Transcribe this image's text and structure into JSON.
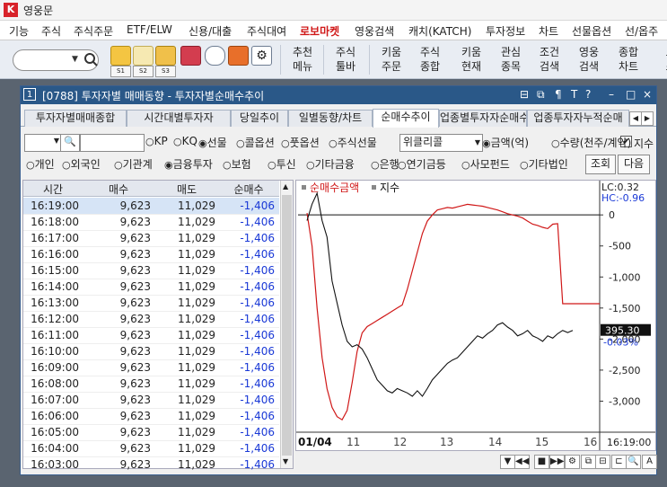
{
  "app": {
    "title": "영웅문",
    "logo": "K"
  },
  "menu": [
    "기능",
    "주식",
    "주식주문",
    "ETF/ELW",
    "신용/대출",
    "주식대여",
    "로보마켓",
    "영웅검색",
    "캐치(KATCH)",
    "투자정보",
    "차트",
    "선물옵션",
    "선/옵주"
  ],
  "menu_highlight": "로보마켓",
  "toolbar": {
    "sub_labels": [
      "S1",
      "S2",
      "S3"
    ],
    "buttons": [
      {
        "line1": "추천",
        "line2": "메뉴"
      },
      {
        "line1": "주식",
        "line2": "툴바"
      },
      {
        "line1": "키움",
        "line2": "주문"
      },
      {
        "line1": "주식",
        "line2": "종합"
      },
      {
        "line1": "키움",
        "line2": "현재"
      },
      {
        "line1": "관심",
        "line2": "종목"
      },
      {
        "line1": "조건",
        "line2": "검색"
      },
      {
        "line1": "영웅",
        "line2": "검색"
      },
      {
        "line1": "종합",
        "line2": "차트"
      },
      {
        "line1": "오",
        "line2": "스"
      }
    ]
  },
  "window": {
    "number": "1",
    "title": "[0788] 투자자별 매매동향 - 투자자별순매수추이",
    "controls": [
      "⊟",
      "⧉",
      "¶",
      "T",
      "?",
      "–",
      "□",
      "×"
    ]
  },
  "tabs": [
    {
      "label": "투자자별매매종합",
      "active": false
    },
    {
      "label": "시간대별투자자",
      "active": false
    },
    {
      "label": "당일추이",
      "active": false
    },
    {
      "label": "일별동향/차트",
      "active": false
    },
    {
      "label": "순매수추이",
      "active": true
    },
    {
      "label": "업종별투자자순매수",
      "active": false
    },
    {
      "label": "업종투자자누적순매",
      "active": false
    }
  ],
  "row1": {
    "market_options": [
      "KP",
      "KQ",
      "선물",
      "콜옵션",
      "풋옵션",
      "주식선물"
    ],
    "market_selected": "선물",
    "weekly_select": "위클리콜",
    "unit_options": [
      "금액(억)",
      "수량(천주/계약)"
    ],
    "unit_selected": "금액(억)",
    "index_check_label": "지수",
    "index_checked": true
  },
  "row2": {
    "investor_options": [
      "개인",
      "외국인",
      "기관계",
      "금융투자",
      "보험",
      "투신",
      "기타금융",
      "은행",
      "연기금등",
      "사모펀드",
      "기타법인"
    ],
    "investor_selected": "금융투자",
    "query_button": "조회",
    "next_button": "다음"
  },
  "table": {
    "headers": [
      "시간",
      "매수",
      "매도",
      "순매수"
    ],
    "rows": [
      [
        "16:19:00",
        "9,623",
        "11,029",
        "-1,406"
      ],
      [
        "16:18:00",
        "9,623",
        "11,029",
        "-1,406"
      ],
      [
        "16:17:00",
        "9,623",
        "11,029",
        "-1,406"
      ],
      [
        "16:16:00",
        "9,623",
        "11,029",
        "-1,406"
      ],
      [
        "16:15:00",
        "9,623",
        "11,029",
        "-1,406"
      ],
      [
        "16:14:00",
        "9,623",
        "11,029",
        "-1,406"
      ],
      [
        "16:13:00",
        "9,623",
        "11,029",
        "-1,406"
      ],
      [
        "16:12:00",
        "9,623",
        "11,029",
        "-1,406"
      ],
      [
        "16:11:00",
        "9,623",
        "11,029",
        "-1,406"
      ],
      [
        "16:10:00",
        "9,623",
        "11,029",
        "-1,406"
      ],
      [
        "16:09:00",
        "9,623",
        "11,029",
        "-1,406"
      ],
      [
        "16:08:00",
        "9,623",
        "11,029",
        "-1,406"
      ],
      [
        "16:07:00",
        "9,623",
        "11,029",
        "-1,406"
      ],
      [
        "16:06:00",
        "9,623",
        "11,029",
        "-1,406"
      ],
      [
        "16:05:00",
        "9,623",
        "11,029",
        "-1,406"
      ],
      [
        "16:04:00",
        "9,623",
        "11,029",
        "-1,406"
      ],
      [
        "16:03:00",
        "9,623",
        "11,029",
        "-1,406"
      ]
    ]
  },
  "chart_data": {
    "type": "line",
    "legend": [
      {
        "name": "순매수금액",
        "color": "#d01818"
      },
      {
        "name": "지수",
        "color": "#111111"
      }
    ],
    "info": {
      "lc": "LC:0.32",
      "hc": "HC:-0.96"
    },
    "y_ticks": [
      "0",
      "-500",
      "-1,000",
      "-1,500",
      "-2,000",
      "-2,500",
      "-3,000"
    ],
    "y_tick_values": [
      0,
      -500,
      -1000,
      -1500,
      -2000,
      -2500,
      -3000
    ],
    "ylim": [
      -3500,
      350
    ],
    "current_price": "395.30",
    "current_change": "-0.03%",
    "x_ticks": [
      "01/04",
      "11",
      "12",
      "13",
      "14",
      "15",
      "16"
    ],
    "time_label": "16:19:00",
    "series": [
      {
        "name": "순매수금액",
        "color": "#d01818",
        "values": [
          30,
          -500,
          -1500,
          -2300,
          -2800,
          -3100,
          -3250,
          -3300,
          -3150,
          -2700,
          -2200,
          -1900,
          -1800,
          -1750,
          -1700,
          -1650,
          -1600,
          -1550,
          -1500,
          -1450,
          -1200,
          -900,
          -600,
          -300,
          -100,
          0,
          80,
          100,
          120,
          110,
          130,
          150,
          170,
          160,
          150,
          140,
          120,
          100,
          80,
          50,
          20,
          0,
          -20,
          -50,
          -100,
          -150,
          -170,
          -200,
          -220,
          -150,
          -140,
          -1430,
          -1430,
          -1430
        ]
      },
      {
        "name": "지수",
        "color": "#111111",
        "values": [
          395.55,
          395.7,
          395.8,
          395.55,
          395.4,
          395.0,
          394.8,
          394.6,
          394.45,
          394.4,
          394.42,
          394.38,
          394.3,
          394.2,
          394.1,
          394.05,
          394.0,
          393.98,
          394.02,
          394.0,
          393.98,
          393.95,
          394.0,
          393.95,
          394.02,
          394.1,
          394.15,
          394.2,
          394.25,
          394.28,
          394.3,
          394.35,
          394.4,
          394.45,
          394.5,
          394.48,
          394.52,
          394.55,
          394.6,
          394.62,
          394.58,
          394.55,
          394.5,
          394.52,
          394.55,
          394.5,
          394.48,
          394.45,
          394.5,
          394.48,
          394.52,
          394.55,
          394.53,
          394.55
        ]
      }
    ]
  },
  "chart_nav": [
    "▼",
    "◀◀",
    "■",
    "▶▶",
    "⚙",
    "⧉",
    "⊟",
    "⊏",
    "🔍",
    "A"
  ]
}
